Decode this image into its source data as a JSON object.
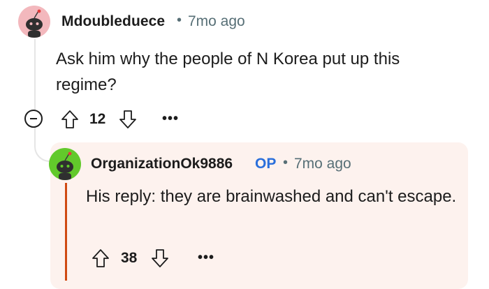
{
  "comments": [
    {
      "author": "Mdoubleduece",
      "separator": "•",
      "time": "7mo ago",
      "body": "Ask him why the people of N Korea put up this regime?",
      "score": "12",
      "more": "•••",
      "avatar_color": "#f3b8bd"
    },
    {
      "author": "OrganizationOk9886",
      "op_badge": "OP",
      "separator": "•",
      "time": "7mo ago",
      "body": "His reply: they are brainwashed and can't escape.",
      "score": "38",
      "more": "•••",
      "avatar_color": "#62c92b",
      "highlight_bg": "#fdf2ee",
      "thread_line_color": "#d04a12"
    }
  ],
  "icons": {
    "upvote": "arrow-up-outline-icon",
    "downvote": "arrow-down-outline-icon",
    "collapse": "minus-circle-icon",
    "avatar": "snoo-avatar-icon"
  },
  "colors": {
    "op_blue": "#2a6fdb",
    "meta_gray": "#576f76"
  }
}
